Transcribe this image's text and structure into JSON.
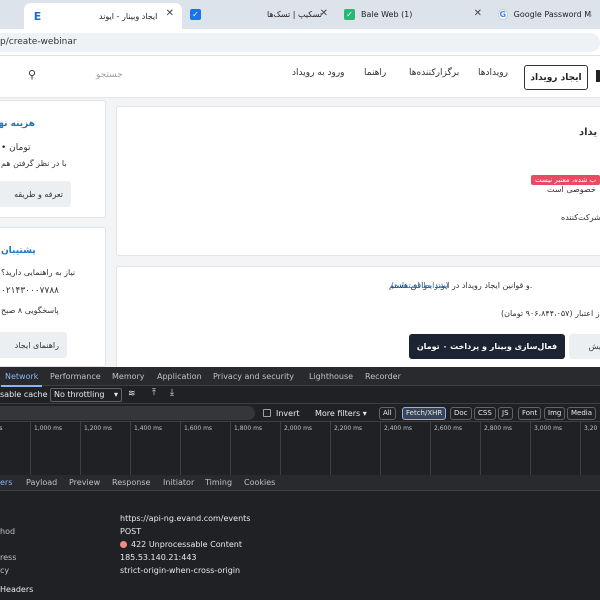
{
  "browser": {
    "tabs": [
      {
        "label": "ایجاد وبینار - ایوند",
        "active": true
      },
      {
        "label": "تسکیپ | تسک‌ها"
      },
      {
        "label": "Bale Web (1)"
      },
      {
        "label": "Google Password Mana"
      }
    ],
    "url": "p/create-webinar"
  },
  "site": {
    "search_placeholder": "جستجو",
    "nav": [
      "ورود به رویداد",
      "راهنما",
      "برگزارکننده‌ها",
      "رویدادها"
    ],
    "create_label": "ایجاد رویداد",
    "left_top": {
      "title": "هزینه نها",
      "line1": "• تومان",
      "line2": "با در نظر گرفتن هم",
      "button": "تعرفه و طریقه"
    },
    "left_bottom": {
      "title": "پشتیبان",
      "line1": "نیاز به راهنمایی دارید؟",
      "line2": "۰۲۱۴۳۰۰۰۷۷۸۸",
      "line3": "پاسخگویی ۸ صبح",
      "button": "راهنمای ایجاد"
    },
    "main_top": {
      "title": "یداد",
      "red_tag": "ب شده، معتبر نیست",
      "line1": "خصوصی است",
      "line2": "با شرکت‌کننده"
    },
    "main_bottom": {
      "terms_text": "و قوانین ایجاد رویداد در ایوند موافق هستم.",
      "terms_link": "(شرایط استفاده)",
      "credit": "ز اعتبار (۹۰۶،۸۴۴،۰۵۷ تومان)",
      "activate_button": "فعال‌سازی وبینار و پرداخت ۰ تومان",
      "preview_button": "یش"
    }
  },
  "devtools": {
    "tabs": [
      "Network",
      "Performance",
      "Memory",
      "Application",
      "Privacy and security",
      "Lighthouse",
      "Recorder"
    ],
    "active_tab": "Network",
    "toolbar": {
      "disable_cache": "sable cache",
      "throttling": "No throttling"
    },
    "filter": {
      "invert": "Invert",
      "more_filters": "More filters",
      "chips": [
        "All",
        "Fetch/XHR",
        "Doc",
        "CSS",
        "JS",
        "Font",
        "Img",
        "Media"
      ],
      "active_chip": "Fetch/XHR"
    },
    "timeline_ticks": [
      "00 ms",
      "1,000 ms",
      "1,200 ms",
      "1,400 ms",
      "1,600 ms",
      "1,800 ms",
      "2,000 ms",
      "2,200 ms",
      "2,400 ms",
      "2,600 ms",
      "2,800 ms",
      "3,000 ms",
      "3,20"
    ],
    "subtabs": [
      "ers",
      "Payload",
      "Preview",
      "Response",
      "Initiator",
      "Timing",
      "Cookies"
    ],
    "headers": [
      {
        "key": "",
        "value": "https://api-ng.evand.com/events"
      },
      {
        "key": "hod",
        "value": "POST"
      },
      {
        "key": "",
        "value": "422 Unprocessable Content",
        "status": true
      },
      {
        "key": "ress",
        "value": "185.53.140.21:443"
      },
      {
        "key": "cy",
        "value": "strict-origin-when-cross-origin"
      }
    ],
    "section_label": "Headers"
  },
  "colors": {
    "accent_blue": "#1a73c8",
    "error_red": "#f28b82",
    "dark_button": "#1c2433",
    "tag_red": "#e84a5f"
  }
}
